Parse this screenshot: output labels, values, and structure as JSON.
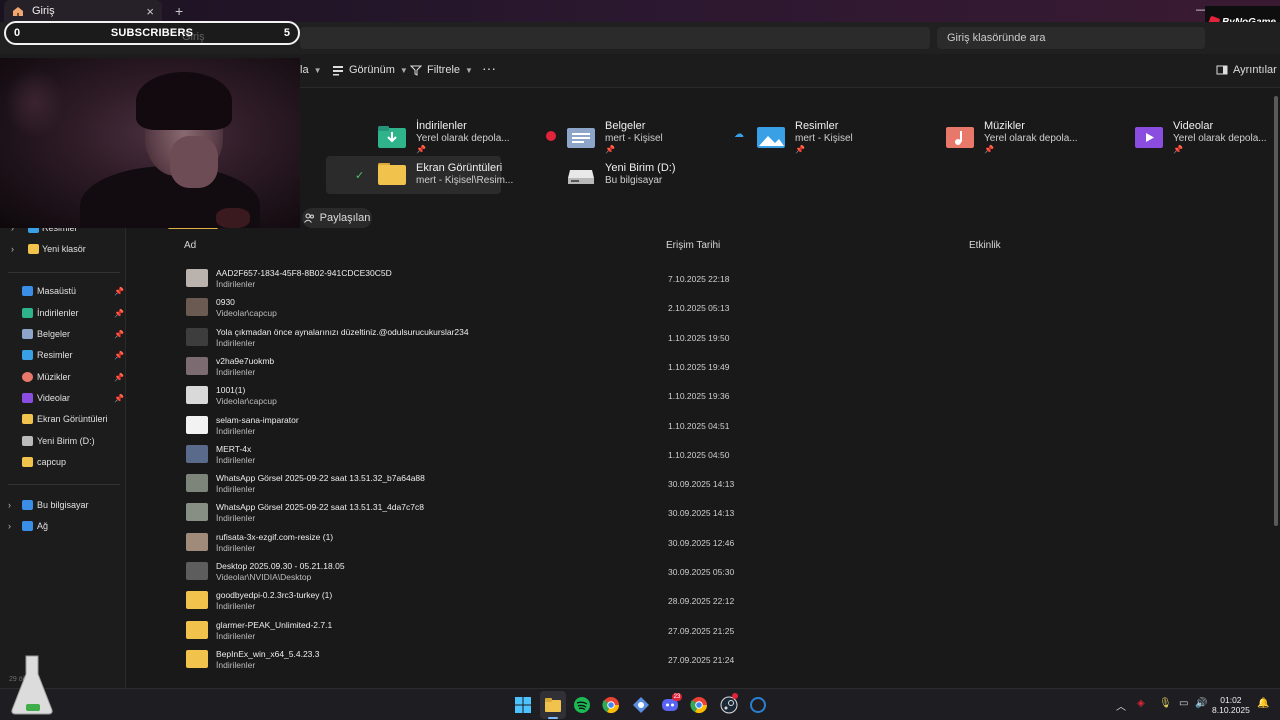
{
  "window": {
    "tab_title": "Giriş",
    "close_glyph": "×",
    "new_tab_glyph": "+",
    "minimize_glyph": "—",
    "brand": "ByNoGame"
  },
  "address": {
    "path": "Giriş",
    "search_placeholder": "Giriş klasöründe ara"
  },
  "overlay": {
    "left_count": "0",
    "label": "SUBSCRIBERS",
    "right_count": "5"
  },
  "toolbar": {
    "view_label": "Görünüm",
    "filter_label": "Filtrele",
    "more_label": "···",
    "details_label": "Ayrıntılar",
    "sort_partial": "la"
  },
  "quick_access": [
    {
      "name": "İndirilenler",
      "sub": "Yerel olarak depola...",
      "icon": "downloads-folder-icon",
      "color": "#2fb38a"
    },
    {
      "name": "Belgeler",
      "sub": "mert - Kişisel",
      "icon": "documents-folder-icon",
      "color": "#8da5c9"
    },
    {
      "name": "Resimler",
      "sub": "mert - Kişisel",
      "icon": "pictures-folder-icon",
      "color": "#3aa0e6"
    },
    {
      "name": "Müzikler",
      "sub": "Yerel olarak depola...",
      "icon": "music-folder-icon",
      "color": "#e8786a"
    },
    {
      "name": "Videolar",
      "sub": "Yerel olarak depola...",
      "icon": "videos-folder-icon",
      "color": "#8a4de0"
    },
    {
      "name": "Ekran Görüntüleri",
      "sub": "mert - Kişisel\\Resim...",
      "icon": "screenshots-folder-icon",
      "color": "#f2c34c"
    },
    {
      "name": "Yeni Birim (D:)",
      "sub": "Bu bilgisayar",
      "icon": "drive-icon",
      "color": "#d0d0d0"
    }
  ],
  "shared_label": "Paylaşılan",
  "sidebar": {
    "top": [
      {
        "label": "Resimler",
        "icon": "pictures-icon",
        "color": "#3aa0e6"
      },
      {
        "label": "Yeni klasör",
        "icon": "folder-icon",
        "color": "#f2c34c"
      }
    ],
    "pinned": [
      {
        "label": "Masaüstü",
        "icon": "desktop-icon",
        "color": "#3a8ee6",
        "pinned": true
      },
      {
        "label": "İndirilenler",
        "icon": "downloads-icon",
        "color": "#2fb38a",
        "pinned": true
      },
      {
        "label": "Belgeler",
        "icon": "documents-icon",
        "color": "#8da5c9",
        "pinned": true
      },
      {
        "label": "Resimler",
        "icon": "pictures-icon",
        "color": "#3aa0e6",
        "pinned": true
      },
      {
        "label": "Müzikler",
        "icon": "music-icon",
        "color": "#e8786a",
        "pinned": true
      },
      {
        "label": "Videolar",
        "icon": "videos-icon",
        "color": "#8a4de0",
        "pinned": true
      },
      {
        "label": "Ekran Görüntüleri",
        "icon": "folder-icon",
        "color": "#f2c34c",
        "pinned": false
      },
      {
        "label": "Yeni Birim (D:)",
        "icon": "drive-icon",
        "color": "#bbbbbb",
        "pinned": false
      },
      {
        "label": "capcup",
        "icon": "folder-icon",
        "color": "#f2c34c",
        "pinned": false
      }
    ],
    "bottom": [
      {
        "label": "Bu bilgisayar",
        "icon": "computer-icon",
        "color": "#3a8ee6"
      },
      {
        "label": "Ağ",
        "icon": "network-icon",
        "color": "#3a8ee6"
      }
    ]
  },
  "columns": {
    "name": "Ad",
    "date": "Erişim Tarihi",
    "activity": "Etkinlik"
  },
  "files": [
    {
      "name": "AAD2F657-1834-45F8-8B02-941CDCE30C5D",
      "loc": "İndirilenler",
      "date": "7.10.2025 22:18",
      "thumb": "#b9b2ad"
    },
    {
      "name": "0930",
      "loc": "Videolar\\capcup",
      "date": "2.10.2025 05:13",
      "thumb": "#6b5a52"
    },
    {
      "name": "Yola çıkmadan önce aynalarınızı düzeltiniz.@odulsurucukurslar234",
      "loc": "İndirilenler",
      "date": "1.10.2025 19:50",
      "thumb": "#3d3d3d"
    },
    {
      "name": "v2ha9e7uokmb",
      "loc": "İndirilenler",
      "date": "1.10.2025 19:49",
      "thumb": "#7c6b70"
    },
    {
      "name": "1001(1)",
      "loc": "Videolar\\capcup",
      "date": "1.10.2025 19:36",
      "thumb": "#d9d9d9"
    },
    {
      "name": "selam-sana-imparator",
      "loc": "İndirilenler",
      "date": "1.10.2025 04:51",
      "thumb": "#f2f2f2"
    },
    {
      "name": "MERT-4x",
      "loc": "İndirilenler",
      "date": "1.10.2025 04:50",
      "thumb": "#5a6a8a"
    },
    {
      "name": "WhatsApp Görsel 2025-09-22 saat 13.51.32_b7a64a88",
      "loc": "İndirilenler",
      "date": "30.09.2025 14:13",
      "thumb": "#7d847a"
    },
    {
      "name": "WhatsApp Görsel 2025-09-22 saat 13.51.31_4da7c7c8",
      "loc": "İndirilenler",
      "date": "30.09.2025 14:13",
      "thumb": "#878f84"
    },
    {
      "name": "rufisata-3x-ezgif.com-resize (1)",
      "loc": "İndirilenler",
      "date": "30.09.2025 12:46",
      "thumb": "#a08b7a"
    },
    {
      "name": "Desktop 2025.09.30 - 05.21.18.05",
      "loc": "Videolar\\NVIDIA\\Desktop",
      "date": "30.09.2025 05:30",
      "thumb": "#5d5d5d"
    },
    {
      "name": "goodbyedpi-0.2.3rc3-turkey (1)",
      "loc": "İndirilenler",
      "date": "28.09.2025 22:12",
      "thumb": "#f2c34c"
    },
    {
      "name": "glarmer-PEAK_Unlimited-2.7.1",
      "loc": "İndirilenler",
      "date": "27.09.2025 21:25",
      "thumb": "#f2c34c"
    },
    {
      "name": "BepInEx_win_x64_5.4.23.3",
      "loc": "İndirilenler",
      "date": "27.09.2025 21:24",
      "thumb": "#f2c34c"
    }
  ],
  "taskbar": {
    "clock_time": "01:02",
    "clock_date": "8.10.2025",
    "badge_discord": "23"
  },
  "watermark": "29 öğe"
}
